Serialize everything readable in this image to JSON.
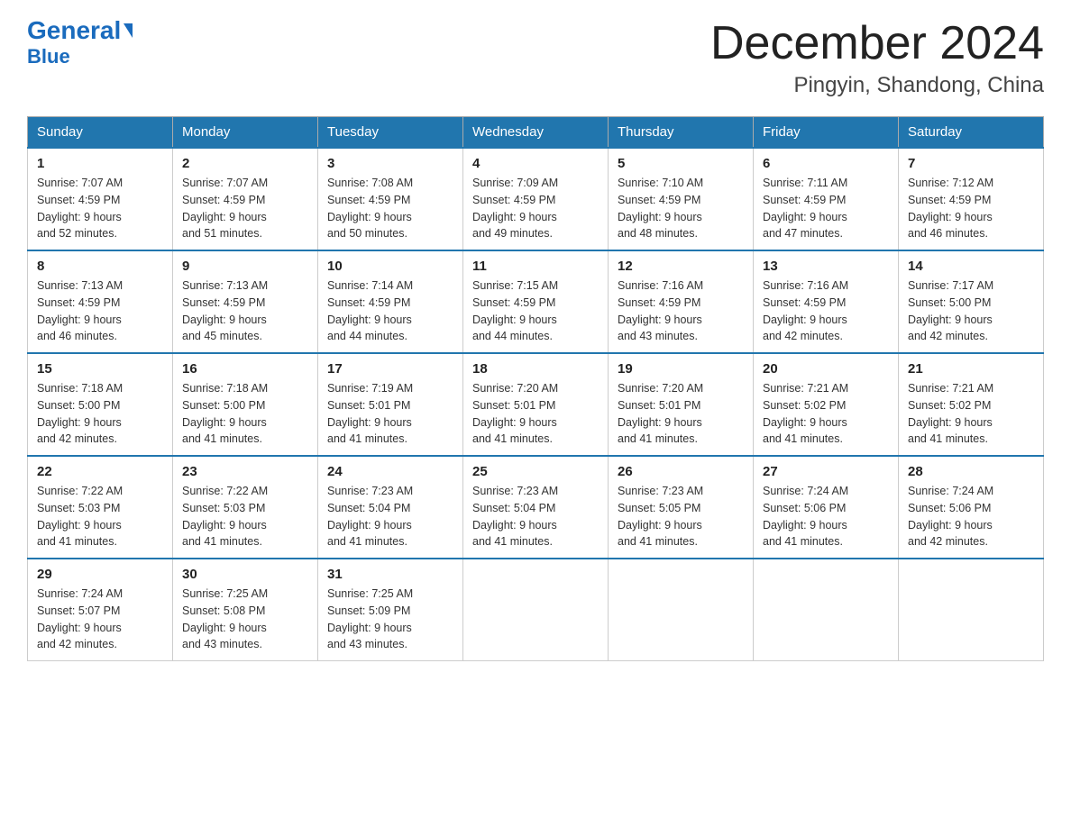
{
  "header": {
    "logo_general": "General",
    "logo_arrow": "▶",
    "logo_blue": "Blue",
    "month_title": "December 2024",
    "location": "Pingyin, Shandong, China"
  },
  "days_of_week": [
    "Sunday",
    "Monday",
    "Tuesday",
    "Wednesday",
    "Thursday",
    "Friday",
    "Saturday"
  ],
  "weeks": [
    [
      {
        "day": "1",
        "sunrise": "7:07 AM",
        "sunset": "4:59 PM",
        "daylight": "9 hours and 52 minutes."
      },
      {
        "day": "2",
        "sunrise": "7:07 AM",
        "sunset": "4:59 PM",
        "daylight": "9 hours and 51 minutes."
      },
      {
        "day": "3",
        "sunrise": "7:08 AM",
        "sunset": "4:59 PM",
        "daylight": "9 hours and 50 minutes."
      },
      {
        "day": "4",
        "sunrise": "7:09 AM",
        "sunset": "4:59 PM",
        "daylight": "9 hours and 49 minutes."
      },
      {
        "day": "5",
        "sunrise": "7:10 AM",
        "sunset": "4:59 PM",
        "daylight": "9 hours and 48 minutes."
      },
      {
        "day": "6",
        "sunrise": "7:11 AM",
        "sunset": "4:59 PM",
        "daylight": "9 hours and 47 minutes."
      },
      {
        "day": "7",
        "sunrise": "7:12 AM",
        "sunset": "4:59 PM",
        "daylight": "9 hours and 46 minutes."
      }
    ],
    [
      {
        "day": "8",
        "sunrise": "7:13 AM",
        "sunset": "4:59 PM",
        "daylight": "9 hours and 46 minutes."
      },
      {
        "day": "9",
        "sunrise": "7:13 AM",
        "sunset": "4:59 PM",
        "daylight": "9 hours and 45 minutes."
      },
      {
        "day": "10",
        "sunrise": "7:14 AM",
        "sunset": "4:59 PM",
        "daylight": "9 hours and 44 minutes."
      },
      {
        "day": "11",
        "sunrise": "7:15 AM",
        "sunset": "4:59 PM",
        "daylight": "9 hours and 44 minutes."
      },
      {
        "day": "12",
        "sunrise": "7:16 AM",
        "sunset": "4:59 PM",
        "daylight": "9 hours and 43 minutes."
      },
      {
        "day": "13",
        "sunrise": "7:16 AM",
        "sunset": "4:59 PM",
        "daylight": "9 hours and 42 minutes."
      },
      {
        "day": "14",
        "sunrise": "7:17 AM",
        "sunset": "5:00 PM",
        "daylight": "9 hours and 42 minutes."
      }
    ],
    [
      {
        "day": "15",
        "sunrise": "7:18 AM",
        "sunset": "5:00 PM",
        "daylight": "9 hours and 42 minutes."
      },
      {
        "day": "16",
        "sunrise": "7:18 AM",
        "sunset": "5:00 PM",
        "daylight": "9 hours and 41 minutes."
      },
      {
        "day": "17",
        "sunrise": "7:19 AM",
        "sunset": "5:01 PM",
        "daylight": "9 hours and 41 minutes."
      },
      {
        "day": "18",
        "sunrise": "7:20 AM",
        "sunset": "5:01 PM",
        "daylight": "9 hours and 41 minutes."
      },
      {
        "day": "19",
        "sunrise": "7:20 AM",
        "sunset": "5:01 PM",
        "daylight": "9 hours and 41 minutes."
      },
      {
        "day": "20",
        "sunrise": "7:21 AM",
        "sunset": "5:02 PM",
        "daylight": "9 hours and 41 minutes."
      },
      {
        "day": "21",
        "sunrise": "7:21 AM",
        "sunset": "5:02 PM",
        "daylight": "9 hours and 41 minutes."
      }
    ],
    [
      {
        "day": "22",
        "sunrise": "7:22 AM",
        "sunset": "5:03 PM",
        "daylight": "9 hours and 41 minutes."
      },
      {
        "day": "23",
        "sunrise": "7:22 AM",
        "sunset": "5:03 PM",
        "daylight": "9 hours and 41 minutes."
      },
      {
        "day": "24",
        "sunrise": "7:23 AM",
        "sunset": "5:04 PM",
        "daylight": "9 hours and 41 minutes."
      },
      {
        "day": "25",
        "sunrise": "7:23 AM",
        "sunset": "5:04 PM",
        "daylight": "9 hours and 41 minutes."
      },
      {
        "day": "26",
        "sunrise": "7:23 AM",
        "sunset": "5:05 PM",
        "daylight": "9 hours and 41 minutes."
      },
      {
        "day": "27",
        "sunrise": "7:24 AM",
        "sunset": "5:06 PM",
        "daylight": "9 hours and 41 minutes."
      },
      {
        "day": "28",
        "sunrise": "7:24 AM",
        "sunset": "5:06 PM",
        "daylight": "9 hours and 42 minutes."
      }
    ],
    [
      {
        "day": "29",
        "sunrise": "7:24 AM",
        "sunset": "5:07 PM",
        "daylight": "9 hours and 42 minutes."
      },
      {
        "day": "30",
        "sunrise": "7:25 AM",
        "sunset": "5:08 PM",
        "daylight": "9 hours and 43 minutes."
      },
      {
        "day": "31",
        "sunrise": "7:25 AM",
        "sunset": "5:09 PM",
        "daylight": "9 hours and 43 minutes."
      },
      null,
      null,
      null,
      null
    ]
  ],
  "labels": {
    "sunrise": "Sunrise:",
    "sunset": "Sunset:",
    "daylight": "Daylight:"
  }
}
